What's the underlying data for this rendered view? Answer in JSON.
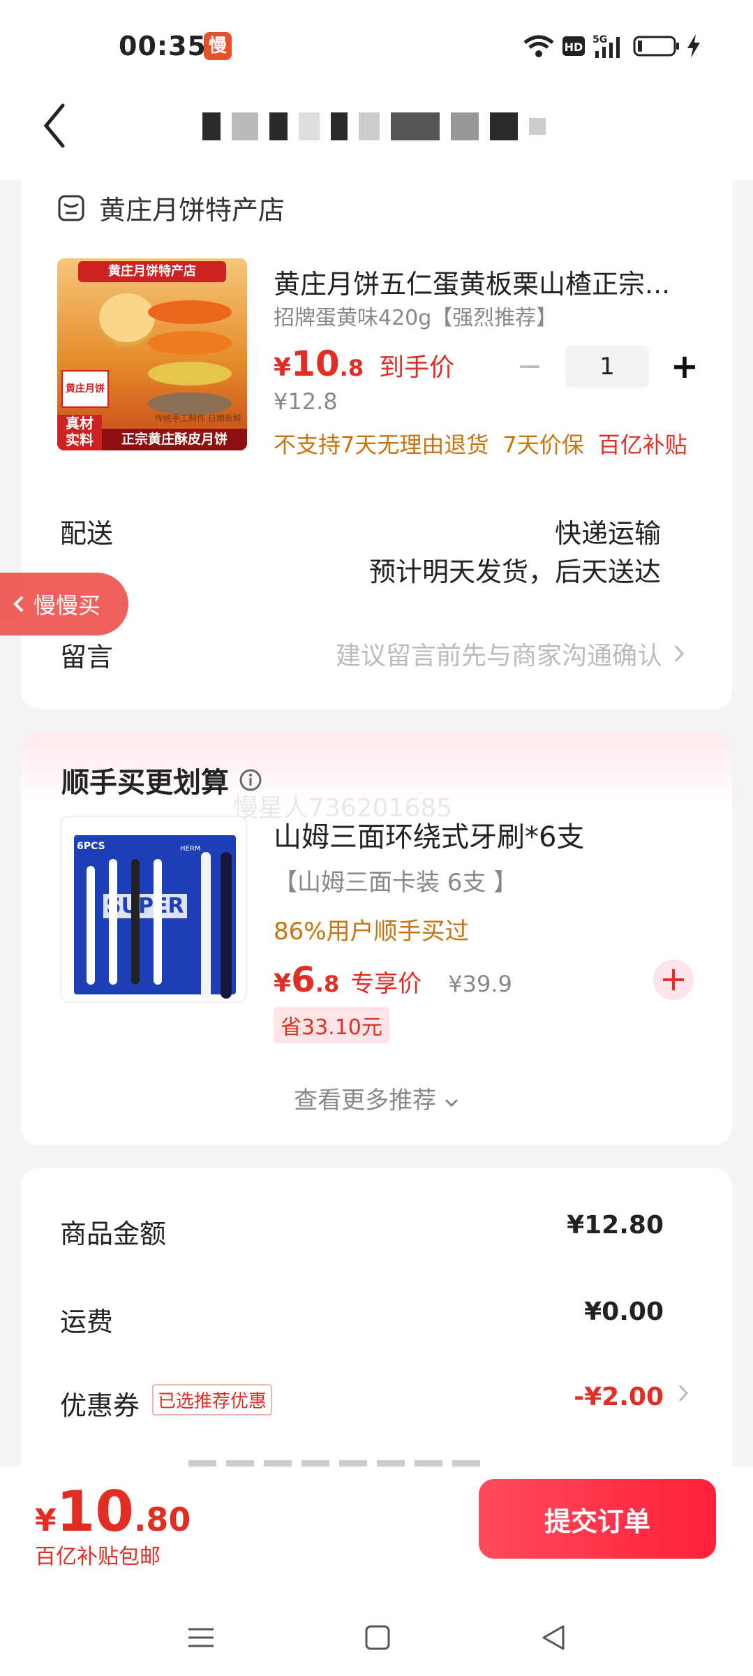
{
  "status": {
    "time": "00:35",
    "app_badge": "慢",
    "icons": [
      "wifi-icon",
      "hd-icon",
      "5g-signal-icon",
      "battery-icon",
      "charging-icon"
    ]
  },
  "header": {
    "back_icon": "chevron-left-icon"
  },
  "store": {
    "name": "黄庄月饼特产店",
    "icon": "store-icon"
  },
  "product": {
    "title": "黄庄月饼五仁蛋黄板栗山楂正宗...",
    "sku": "招牌蛋黄味420g【强烈推荐】",
    "price_symbol": "¥",
    "price_int": "10",
    "price_dec": ".8",
    "price_label": "到手价",
    "original_price": "¥12.8",
    "quantity": "1",
    "tags": [
      "不支持7天无理由退货",
      "7天价保",
      "百亿补贴"
    ],
    "image_texts": {
      "top_banner": "黄庄月饼特产店",
      "box_brand": "黄庄月饼",
      "handmade": "传统手工制作 日期新鲜",
      "corner_line1": "真材",
      "corner_line2": "实料",
      "bottom": "正宗黄庄酥皮月饼"
    }
  },
  "delivery": {
    "label": "配送",
    "method": "快递运输",
    "estimate": "预计明天发货，后天送达"
  },
  "message": {
    "label": "留言",
    "hint": "建议留言前先与商家沟通确认"
  },
  "floating": {
    "slow_buy": "慢慢买"
  },
  "addon": {
    "section_title": "顺手买更划算",
    "watermark": "慢星人736201685",
    "title": "山姆三面环绕式牙刷*6支",
    "sku": "【山姆三面卡装 6支 】",
    "bought": "86%用户顺手买过",
    "price_symbol": "¥",
    "price_int": "6",
    "price_dec": ".8",
    "price_label": "专享价",
    "original_price": "¥39.9",
    "save": "省33.10元",
    "image_texts": {
      "pcs": "6PCS",
      "brand": "SUPER",
      "hm": "HERM"
    },
    "more": "查看更多推荐"
  },
  "summary": {
    "goods_label": "商品金额",
    "goods_value": "¥12.80",
    "shipping_label": "运费",
    "shipping_value": "¥0.00",
    "coupon_label": "优惠券",
    "coupon_badge": "已选推荐优惠",
    "coupon_value": "-¥2.00"
  },
  "bottom": {
    "total_symbol": "¥",
    "total_int": "10",
    "total_dec": ".80",
    "note": "百亿补贴包邮",
    "submit": "提交订单"
  },
  "nav": {
    "icons": [
      "menu-icon",
      "home-icon",
      "back-icon"
    ]
  }
}
